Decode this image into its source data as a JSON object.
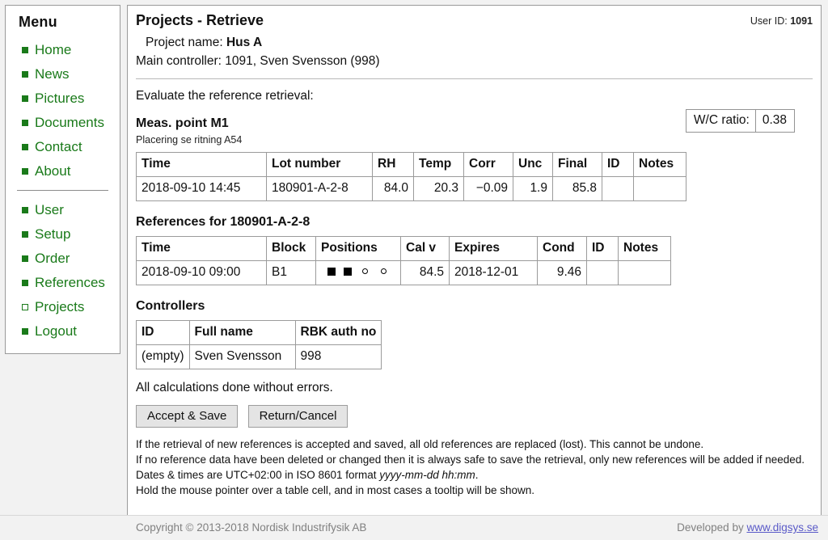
{
  "sidebar": {
    "title": "Menu",
    "group1": [
      {
        "label": "Home",
        "state": "normal"
      },
      {
        "label": "News",
        "state": "normal"
      },
      {
        "label": "Pictures",
        "state": "normal"
      },
      {
        "label": "Documents",
        "state": "normal"
      },
      {
        "label": "Contact",
        "state": "normal"
      },
      {
        "label": "About",
        "state": "normal"
      }
    ],
    "group2": [
      {
        "label": "User",
        "state": "normal"
      },
      {
        "label": "Setup",
        "state": "normal"
      },
      {
        "label": "Order",
        "state": "normal"
      },
      {
        "label": "References",
        "state": "normal"
      },
      {
        "label": "Projects",
        "state": "current"
      },
      {
        "label": "Logout",
        "state": "normal"
      }
    ],
    "accent_color": "#1a7a1a"
  },
  "header": {
    "title": "Projects - Retrieve",
    "user_id_label": "User ID:",
    "user_id_value": "1091",
    "project_name_label": "Project name:",
    "project_name_value": "Hus A",
    "main_controller_label": "Main controller:",
    "main_controller_value": "1091, Sven Svensson (998)"
  },
  "main": {
    "intro": "Evaluate the reference retrieval:",
    "meas_point": {
      "heading": "Meas. point M1",
      "subtext": "Placering se ritning A54"
    },
    "wc_ratio": {
      "label": "W/C ratio:",
      "value": "0.38"
    },
    "meas_table": {
      "columns": [
        "Time",
        "Lot number",
        "RH",
        "Temp",
        "Corr",
        "Unc",
        "Final",
        "ID",
        "Notes"
      ],
      "rows": [
        {
          "time": "2018-09-10 14:45",
          "lot_number": "180901-A-2-8",
          "rh": "84.0",
          "temp": "20.3",
          "corr": "−0.09",
          "unc": "1.9",
          "final": "85.8",
          "id": "",
          "notes": ""
        }
      ]
    },
    "references": {
      "heading": "References for 180901-A-2-8",
      "columns": [
        "Time",
        "Block",
        "Positions",
        "Cal v",
        "Expires",
        "Cond",
        "ID",
        "Notes"
      ],
      "rows": [
        {
          "time": "2018-09-10 09:00",
          "block": "B1",
          "positions": [
            "filled-square",
            "filled-square",
            "hollow-circle",
            "hollow-circle"
          ],
          "cal_v": "84.5",
          "expires": "2018-12-01",
          "cond": "9.46",
          "id": "",
          "notes": ""
        }
      ]
    },
    "controllers": {
      "heading": "Controllers",
      "columns": [
        "ID",
        "Full name",
        "RBK auth no"
      ],
      "rows": [
        {
          "id": "(empty)",
          "full_name": "Sven Svensson",
          "rbk_auth_no": "998"
        }
      ]
    },
    "status": "All calculations done without errors.",
    "buttons": {
      "accept": "Accept & Save",
      "cancel": "Return/Cancel"
    },
    "notes": {
      "line1": "If the retrieval of new references is accepted and saved, all old references are replaced (lost). This cannot be undone.",
      "line2": "If no reference data have been deleted or changed then it is always safe to save the retrieval, only new references will be added if needed.",
      "line3_pre": "Dates & times are UTC+02:00 in ISO 8601 format ",
      "line3_italic": "yyyy-mm-dd hh:mm",
      "line3_post": ".",
      "line4": "Hold the mouse pointer over a table cell, and in most cases a tooltip will be shown."
    }
  },
  "footer": {
    "copyright": "Copyright © 2013-2018 Nordisk Industrifysik AB",
    "developed_by": "Developed by",
    "developer_link": "www.digsys.se"
  }
}
